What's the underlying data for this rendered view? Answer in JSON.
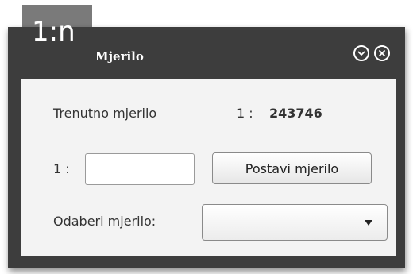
{
  "window": {
    "badge": "1:n",
    "title": "Mjerilo"
  },
  "controls": {
    "collapse_icon": "chevron-down-icon",
    "close_icon": "close-icon"
  },
  "scale": {
    "current_label": "Trenutno mjerilo",
    "current_prefix": "1 :",
    "current_value": "243746",
    "input_prefix": "1 :",
    "input_value": "",
    "set_button_label": "Postavi mjerilo",
    "select_label": "Odaberi mjerilo:",
    "select_value": ""
  },
  "colors": {
    "panel": "#3d3d3d",
    "badge": "#7a7a7a",
    "content": "#f3f3f3"
  }
}
